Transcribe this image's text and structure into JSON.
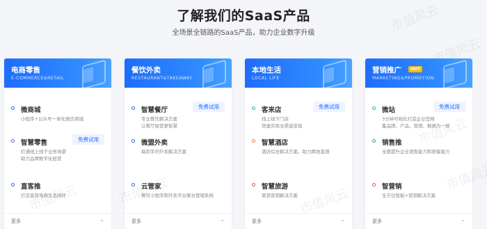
{
  "header": {
    "title": "了解我们的SaaS产品",
    "subtitle": "全场景全链路的SaaS产品，助力企业数字升级"
  },
  "watermark": "市值风云",
  "trial_label": "免费试用",
  "more_label": "更多",
  "cards": [
    {
      "title": "电商零售",
      "subtitle": "E-COMMERCE&RETAIL",
      "items": [
        {
          "name": "微商城",
          "desc": [
            "小程序+公众号一体化微信商城"
          ],
          "trial": false
        },
        {
          "name": "智慧零售",
          "desc": [
            "打通线上线下业务场景",
            "助力品牌数字化经营"
          ],
          "trial": true
        },
        {
          "name": "直客推",
          "desc": [
            "打造直营电商生态闭环"
          ],
          "trial": false
        }
      ]
    },
    {
      "title": "餐饮外卖",
      "subtitle": "RESTAURANT&TAKEAWAY",
      "items": [
        {
          "name": "智慧餐厅",
          "desc": [
            "专业餐饮解决方案",
            "让餐厅经营更智慧"
          ],
          "trial": true
        },
        {
          "name": "微盟外卖",
          "desc": [
            "搞到手的外卖解决方案"
          ],
          "trial": false
        },
        {
          "name": "云管家",
          "desc": [
            "餐饮小程序和外卖平台聚合管理系统"
          ],
          "trial": false
        }
      ]
    },
    {
      "title": "本地生活",
      "subtitle": "LOCAL LIFE",
      "items": [
        {
          "name": "客来店",
          "desc": [
            "线上线下门店",
            "快速实现全渠道变现"
          ],
          "trial": true
        },
        {
          "name": "智慧酒店",
          "desc": [
            "酒店综合解决方案，助力精准直销"
          ],
          "trial": false
        },
        {
          "name": "智慧旅游",
          "desc": [
            "旅游营销解决方案"
          ],
          "trial": false
        }
      ]
    },
    {
      "title": "营销推广",
      "subtitle": "MARKETING&PROMOTION",
      "badge": "HOT",
      "items": [
        {
          "name": "微站",
          "desc": [
            "3分钟可视化打造企业官网",
            "集品牌、产品、营销、数据为一体"
          ],
          "trial": true
        },
        {
          "name": "销售推",
          "desc": [
            "全面提升企业销售能力和获客能力"
          ],
          "trial": false
        },
        {
          "name": "智营销",
          "desc": [
            "全方位智能+营销解决方案"
          ],
          "trial": false
        }
      ]
    }
  ],
  "colors": {
    "accent": "#1f6dfb",
    "dots": [
      "#1f6dfb",
      "#8a4bd8",
      "#1f6dfb",
      "#1f6dfb",
      "#1f6dfb",
      "#1f6dfb",
      "#20b7a0",
      "#f0823a",
      "#e24b5b",
      "#20b7a0",
      "#2bb24c",
      "#e24b5b"
    ]
  }
}
